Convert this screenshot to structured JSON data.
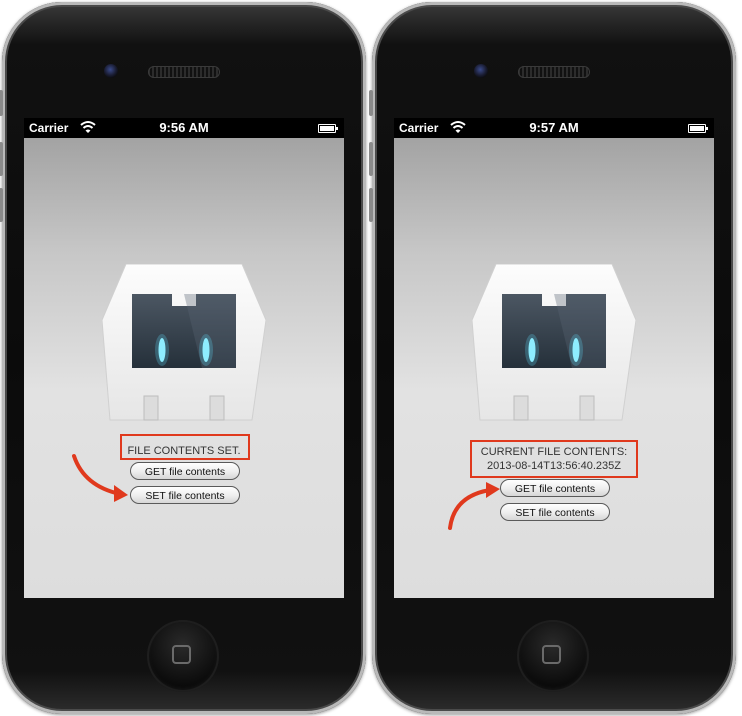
{
  "phones": [
    {
      "carrier": "Carrier",
      "time": "9:56 AM",
      "message_lines": [
        "FILE CONTENTS SET."
      ],
      "buttons": {
        "get_label": "GET file contents",
        "set_label": "SET file contents"
      },
      "highlighted_button": "set"
    },
    {
      "carrier": "Carrier",
      "time": "9:57 AM",
      "message_lines": [
        "CURRENT FILE CONTENTS:",
        "2013-08-14T13:56:40.235Z"
      ],
      "buttons": {
        "get_label": "GET file contents",
        "set_label": "SET file contents"
      },
      "highlighted_button": "get"
    }
  ],
  "icons": [
    "camera-icon",
    "wifi-icon",
    "battery-icon",
    "cordova-logo-icon",
    "home-icon",
    "annotation-arrow-icon"
  ],
  "colors": {
    "highlight": "#e0391d",
    "arrow": "#e0391d"
  }
}
